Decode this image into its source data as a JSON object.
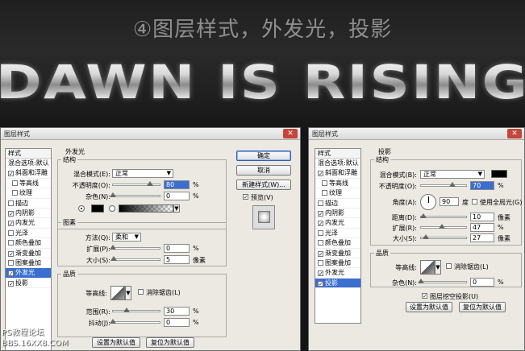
{
  "banner": {
    "caption": "④图层样式，外发光，投影",
    "title": "DAWN IS RISING"
  },
  "left_dialog": {
    "title": "图层样式",
    "list_header": "样式",
    "list_items": [
      {
        "label": "混合选项:默认",
        "checked": null,
        "selected": false,
        "indent": false
      },
      {
        "label": "斜面和浮雕",
        "checked": true,
        "selected": false,
        "indent": false
      },
      {
        "label": "等高线",
        "checked": false,
        "selected": false,
        "indent": true
      },
      {
        "label": "纹理",
        "checked": false,
        "selected": false,
        "indent": true
      },
      {
        "label": "描边",
        "checked": false,
        "selected": false,
        "indent": false
      },
      {
        "label": "内阴影",
        "checked": true,
        "selected": false,
        "indent": false
      },
      {
        "label": "内发光",
        "checked": true,
        "selected": false,
        "indent": false
      },
      {
        "label": "光泽",
        "checked": false,
        "selected": false,
        "indent": false
      },
      {
        "label": "颜色叠加",
        "checked": false,
        "selected": false,
        "indent": false
      },
      {
        "label": "渐变叠加",
        "checked": true,
        "selected": false,
        "indent": false
      },
      {
        "label": "图案叠加",
        "checked": false,
        "selected": false,
        "indent": false
      },
      {
        "label": "外发光",
        "checked": true,
        "selected": true,
        "indent": false
      },
      {
        "label": "投影",
        "checked": true,
        "selected": false,
        "indent": false
      }
    ],
    "section_title": "外发光",
    "structure": {
      "legend": "结构",
      "blend_mode_label": "混合模式(E):",
      "blend_mode_value": "正常",
      "opacity_label": "不透明度(O):",
      "opacity_value": "80",
      "opacity_unit": "%",
      "opacity_fraction": 0.8,
      "noise_label": "杂色(N):",
      "noise_value": "0",
      "noise_unit": "%",
      "noise_fraction": 0.0,
      "glow_color": "#000000"
    },
    "elements": {
      "legend": "图素",
      "technique_label": "方法(Q):",
      "technique_value": "柔和",
      "spread_label": "扩展(P):",
      "spread_value": "0",
      "spread_unit": "%",
      "spread_fraction": 0.0,
      "size_label": "大小(S):",
      "size_value": "5",
      "size_unit": "像素",
      "size_fraction": 0.02
    },
    "quality": {
      "legend": "品质",
      "contour_label": "等高线:",
      "antialias_label": "消除锯齿(L)",
      "range_label": "范围(R):",
      "range_value": "30",
      "range_unit": "%",
      "range_fraction": 0.3,
      "jitter_label": "抖动(J):",
      "jitter_value": "0",
      "jitter_unit": "%",
      "jitter_fraction": 0.0
    },
    "default_btn": "设置为默认值",
    "reset_btn": "复位为默认值",
    "ok_btn": "确定",
    "cancel_btn": "取消",
    "new_style_btn": "新建样式(W)...",
    "preview_label": "预览(V)"
  },
  "right_dialog": {
    "title": "图层样式",
    "list_header": "样式",
    "list_items": [
      {
        "label": "混合选项:默认",
        "checked": null,
        "selected": false,
        "indent": false
      },
      {
        "label": "斜面和浮雕",
        "checked": true,
        "selected": false,
        "indent": false
      },
      {
        "label": "等高线",
        "checked": false,
        "selected": false,
        "indent": true
      },
      {
        "label": "纹理",
        "checked": false,
        "selected": false,
        "indent": true
      },
      {
        "label": "描边",
        "checked": false,
        "selected": false,
        "indent": false
      },
      {
        "label": "内阴影",
        "checked": true,
        "selected": false,
        "indent": false
      },
      {
        "label": "内发光",
        "checked": true,
        "selected": false,
        "indent": false
      },
      {
        "label": "光泽",
        "checked": false,
        "selected": false,
        "indent": false
      },
      {
        "label": "颜色叠加",
        "checked": false,
        "selected": false,
        "indent": false
      },
      {
        "label": "渐变叠加",
        "checked": true,
        "selected": false,
        "indent": false
      },
      {
        "label": "图案叠加",
        "checked": false,
        "selected": false,
        "indent": false
      },
      {
        "label": "外发光",
        "checked": true,
        "selected": false,
        "indent": false
      },
      {
        "label": "投影",
        "checked": true,
        "selected": true,
        "indent": false
      }
    ],
    "section_title": "投影",
    "structure": {
      "legend": "结构",
      "blend_mode_label": "混合模式(B):",
      "blend_mode_value": "正常",
      "shadow_color": "#000000",
      "opacity_label": "不透明度(O):",
      "opacity_value": "70",
      "opacity_unit": "%",
      "opacity_fraction": 0.7,
      "angle_label": "角度(A):",
      "angle_value": "90",
      "angle_unit": "度",
      "global_light_label": "使用全局光(G)",
      "distance_label": "距离(D):",
      "distance_value": "10",
      "distance_unit": "像素",
      "distance_fraction": 0.05,
      "spread_label": "扩展(R):",
      "spread_value": "47",
      "spread_unit": "%",
      "spread_fraction": 0.47,
      "size_label": "大小(S):",
      "size_value": "27",
      "size_unit": "像素",
      "size_fraction": 0.11
    },
    "quality": {
      "legend": "品质",
      "contour_label": "等高线:",
      "antialias_label": "消除锯齿(L)",
      "noise_label": "杂色(N):",
      "noise_value": "0",
      "noise_unit": "%",
      "noise_fraction": 0.0
    },
    "knockout_label": "图层挖空投影(U)",
    "default_btn": "设置为默认值",
    "reset_btn": "复位为默认值"
  },
  "watermark": {
    "line1": "PS教程论坛",
    "line2": "BBS.16XX8.COM"
  }
}
